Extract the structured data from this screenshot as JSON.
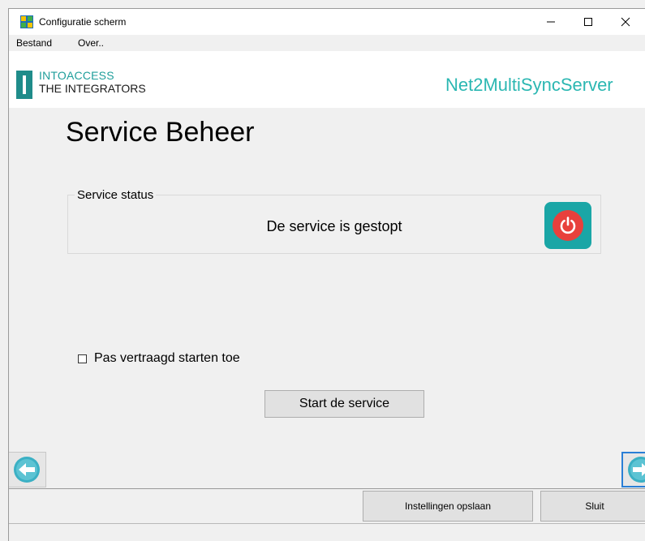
{
  "window": {
    "title": "Configuratie scherm",
    "controls": {
      "minimize": "—",
      "maximize": "☐",
      "close": "✕"
    }
  },
  "menu": {
    "items": [
      {
        "label": "Bestand"
      },
      {
        "label": "Over.."
      }
    ]
  },
  "banner": {
    "logo_line1": "INTOACCESS",
    "logo_line2": "THE INTEGRATORS",
    "product_name": "Net2MultiSyncServer"
  },
  "page": {
    "title": "Service Beheer"
  },
  "service_status": {
    "group_label": "Service status",
    "status_text": "De service is gestopt",
    "icon": "power-icon",
    "state": "stopped"
  },
  "delayed_start": {
    "label": "Pas vertraagd starten toe",
    "checked": false
  },
  "start_button": {
    "label": "Start de service"
  },
  "navigation": {
    "back_icon": "arrow-left-icon",
    "next_icon": "arrow-right-icon"
  },
  "footer": {
    "save_label": "Instellingen opslaan",
    "close_label": "Sluit"
  },
  "colors": {
    "accent": "#1aa6a6",
    "brand_text": "#2bb7b2",
    "power_red": "#e8403c",
    "focus_border": "#2a7fd6"
  }
}
